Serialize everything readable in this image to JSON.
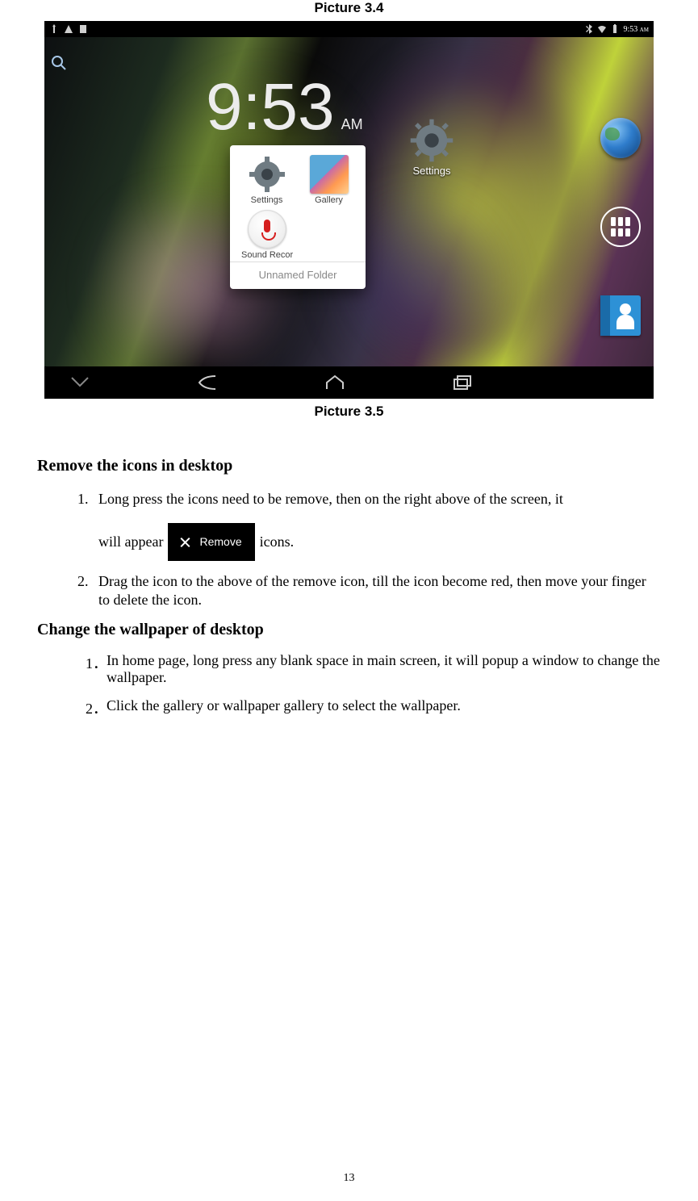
{
  "captions": {
    "top": "Picture 3.4",
    "mid": "Picture 3.5"
  },
  "screenshot": {
    "status_time": "9:53",
    "status_ampm": "AM",
    "clock": {
      "hour": "9",
      "minute": "53",
      "ampm": "AM"
    },
    "side_settings_label": "Settings",
    "folder": {
      "items": [
        {
          "label": "Settings"
        },
        {
          "label": "Gallery"
        },
        {
          "label": "Sound Recorder"
        }
      ],
      "title": "Unnamed Folder"
    }
  },
  "doc": {
    "section1_heading": "Remove the icons in desktop",
    "step1_a": "Long press the icons need to be remove, then on the right above of the screen, it",
    "step1_b": "will appear",
    "remove_label": "Remove",
    "step1_c": "icons.",
    "step2": "Drag the icon to the above of the remove icon, till the icon become red, then move your finger to delete the icon.",
    "section2_heading": "Change the wallpaper of desktop",
    "w1": "In home page, long press any blank space in main screen, it will popup a window to change the wallpaper.",
    "w2": "Click the gallery or wallpaper gallery to select the wallpaper.",
    "page_number": "13"
  }
}
